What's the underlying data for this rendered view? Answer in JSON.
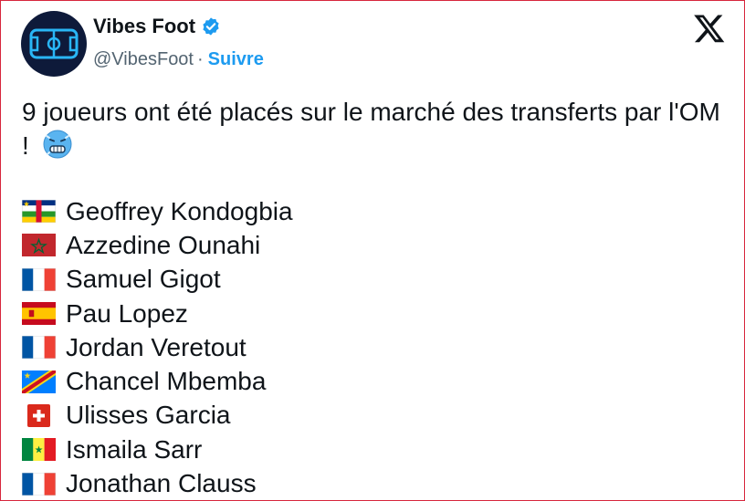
{
  "account": {
    "display_name": "Vibes Foot",
    "handle": "@VibesFoot",
    "separator": "·",
    "follow_label": "Suivre",
    "verified": true
  },
  "tweet": {
    "text": "9 joueurs ont été placés sur le marché des transferts par l'OM !",
    "emoji": "cold-face-emoji"
  },
  "players": [
    {
      "flag": "central-african-republic-flag",
      "name": "Geoffrey Kondogbia"
    },
    {
      "flag": "morocco-flag",
      "name": "Azzedine Ounahi"
    },
    {
      "flag": "france-flag",
      "name": "Samuel Gigot"
    },
    {
      "flag": "spain-flag",
      "name": "Pau Lopez"
    },
    {
      "flag": "france-flag",
      "name": "Jordan Veretout"
    },
    {
      "flag": "dr-congo-flag",
      "name": "Chancel Mbemba"
    },
    {
      "flag": "switzerland-flag",
      "name": "Ulisses Garcia"
    },
    {
      "flag": "senegal-flag",
      "name": "Ismaila Sarr"
    },
    {
      "flag": "france-flag",
      "name": "Jonathan Clauss"
    }
  ],
  "colors": {
    "accent": "#1d9bf0",
    "text": "#0f1419",
    "muted": "#536471",
    "border": "#d7263d"
  }
}
